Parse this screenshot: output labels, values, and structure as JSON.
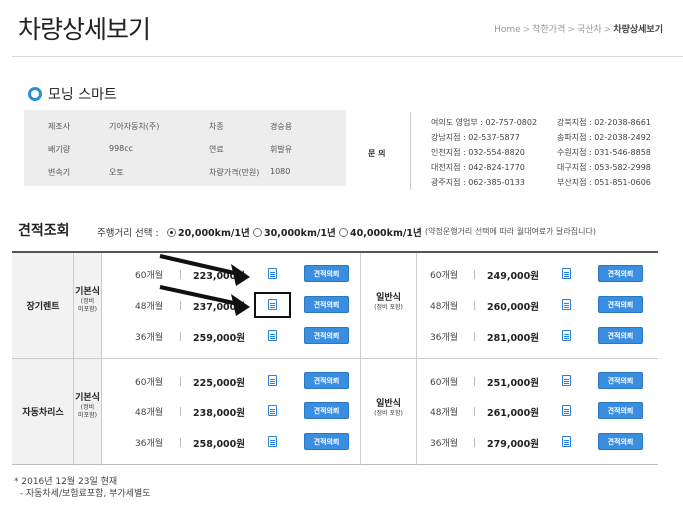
{
  "page": {
    "title": "차량상세보기",
    "breadcrumb": [
      "Home",
      "착한가격",
      "국산차",
      "차량상세보기"
    ]
  },
  "car": {
    "name": "모닝 스마트",
    "specs": [
      {
        "label": "제조사",
        "value": "기아자동차(주)"
      },
      {
        "label": "차종",
        "value": "경승용"
      },
      {
        "label": "배기량",
        "value": "998cc"
      },
      {
        "label": "연료",
        "value": "휘발유"
      },
      {
        "label": "변속기",
        "value": "오토"
      },
      {
        "label": "차량가격(만원)",
        "value": "1080"
      }
    ]
  },
  "contact": {
    "label": "문 의",
    "left": [
      "여의도 영업부 : 02-757-0802",
      "강남지점 : 02-537-5877",
      "인천지점 : 032-554-8820",
      "대전지점 : 042-824-1770",
      "광주지점 : 062-385-0133"
    ],
    "right": [
      "강북지점 : 02-2038-8661",
      "송파지점 : 02-2038-2492",
      "수원지점 : 031-546-8858",
      "대구지점 : 053-582-2998",
      "부산지점 : 051-851-0606"
    ]
  },
  "estimate": {
    "title": "견적조회",
    "distance_label": "주행거리 선택 :",
    "options": [
      "20,000km/1년",
      "30,000km/1년",
      "40,000km/1년"
    ],
    "selected_option": "20,000km/1년",
    "note": "(약정운행거리 선택에 따라 월대여료가 달라집니다)",
    "button_label": "견적의뢰",
    "sections": [
      {
        "category": "장기렌트",
        "basic": {
          "name": "기본식",
          "sub": [
            "(정비",
            "미포함)"
          ],
          "rows": [
            {
              "months": "60개월",
              "price": "223,000원"
            },
            {
              "months": "48개월",
              "price": "237,000원"
            },
            {
              "months": "36개월",
              "price": "259,000원"
            }
          ]
        },
        "general": {
          "name": "일반식",
          "sub": [
            "(정비 포함)"
          ],
          "rows": [
            {
              "months": "60개월",
              "price": "249,000원"
            },
            {
              "months": "48개월",
              "price": "260,000원"
            },
            {
              "months": "36개월",
              "price": "281,000원"
            }
          ]
        }
      },
      {
        "category": "자동차리스",
        "basic": {
          "name": "기본식",
          "sub": [
            "(정비",
            "미포함)"
          ],
          "rows": [
            {
              "months": "60개월",
              "price": "225,000원"
            },
            {
              "months": "48개월",
              "price": "238,000원"
            },
            {
              "months": "36개월",
              "price": "258,000원"
            }
          ]
        },
        "general": {
          "name": "일반식",
          "sub": [
            "(정비 포함)"
          ],
          "rows": [
            {
              "months": "60개월",
              "price": "251,000원"
            },
            {
              "months": "48개월",
              "price": "261,000원"
            },
            {
              "months": "36개월",
              "price": "279,000원"
            }
          ]
        }
      }
    ]
  },
  "footnote": [
    "* 2016년 12월 23일 현재",
    "  - 자동차세/보험료포함, 부가세별도"
  ],
  "colors": {
    "accent": "#2b8fd6",
    "button": "#3a8ee0"
  }
}
